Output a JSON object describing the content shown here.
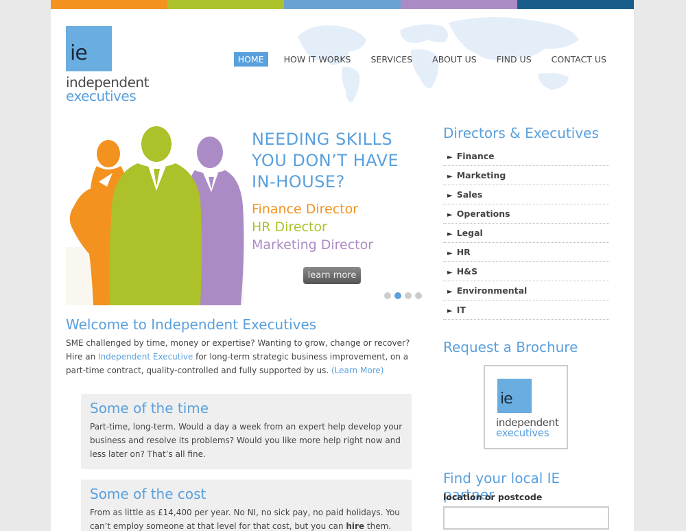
{
  "colors": {
    "orange": "#f3921e",
    "green": "#acc12a",
    "blue": "#6aa3d3",
    "purple": "#ab8bc6",
    "navy": "#1a5d8a",
    "accent": "#5aa0dc"
  },
  "logo": {
    "mark": "ie",
    "line1": "independent",
    "line2": "executives"
  },
  "nav": {
    "items": [
      {
        "label": "HOME",
        "active": true
      },
      {
        "label": "HOW IT WORKS"
      },
      {
        "label": "SERVICES"
      },
      {
        "label": "ABOUT US"
      },
      {
        "label": "FIND US"
      },
      {
        "label": "CONTACT US"
      }
    ]
  },
  "slider": {
    "title_line1": "NEEDING SKILLS",
    "title_line2": "YOU DON’T HAVE",
    "title_line3": "IN-HOUSE?",
    "role1": "Finance Director",
    "role2": "HR Director",
    "role3": "Marketing Director",
    "button": "learn more",
    "active_slide": 2,
    "slide_count": 4
  },
  "welcome": {
    "title": "Welcome to Independent Executives",
    "line1": "SME challenged by time, money or expertise? Wanting to grow, change or recover?",
    "line2_pre": "Hire an ",
    "line2_link": "Independent Executive",
    "line2_post": " for long-term strategic business improvement, on a part-time contract, quality-controlled and fully supported by us. ",
    "learn_more": "(Learn More)"
  },
  "boxes": [
    {
      "title": "Some of the time",
      "text": "Part-time, long-term. Would a day a week from an expert help develop your business and resolve its problems? Would you like more help right now and less later on? That’s all fine."
    },
    {
      "title": "Some of the cost",
      "text_pre": "From as little as £14,400 per year. No NI, no sick pay, no paid holidays. You can’t employ someone at that level for that cost, but you can ",
      "text_bold": "hire",
      "text_post": " them."
    }
  ],
  "sidebar": {
    "directors_title": "Directors & Executives",
    "items": [
      "Finance",
      "Marketing",
      "Sales",
      "Operations",
      "Legal",
      "HR",
      "H&S",
      "Environmental",
      "IT"
    ],
    "brochure_title": "Request a Brochure",
    "brochure_logo": {
      "mark": "ie",
      "line1": "independent",
      "line2": "executives"
    },
    "partner_title": "Find your local IE partner",
    "location_label": "location or postcode",
    "location_value": ""
  }
}
